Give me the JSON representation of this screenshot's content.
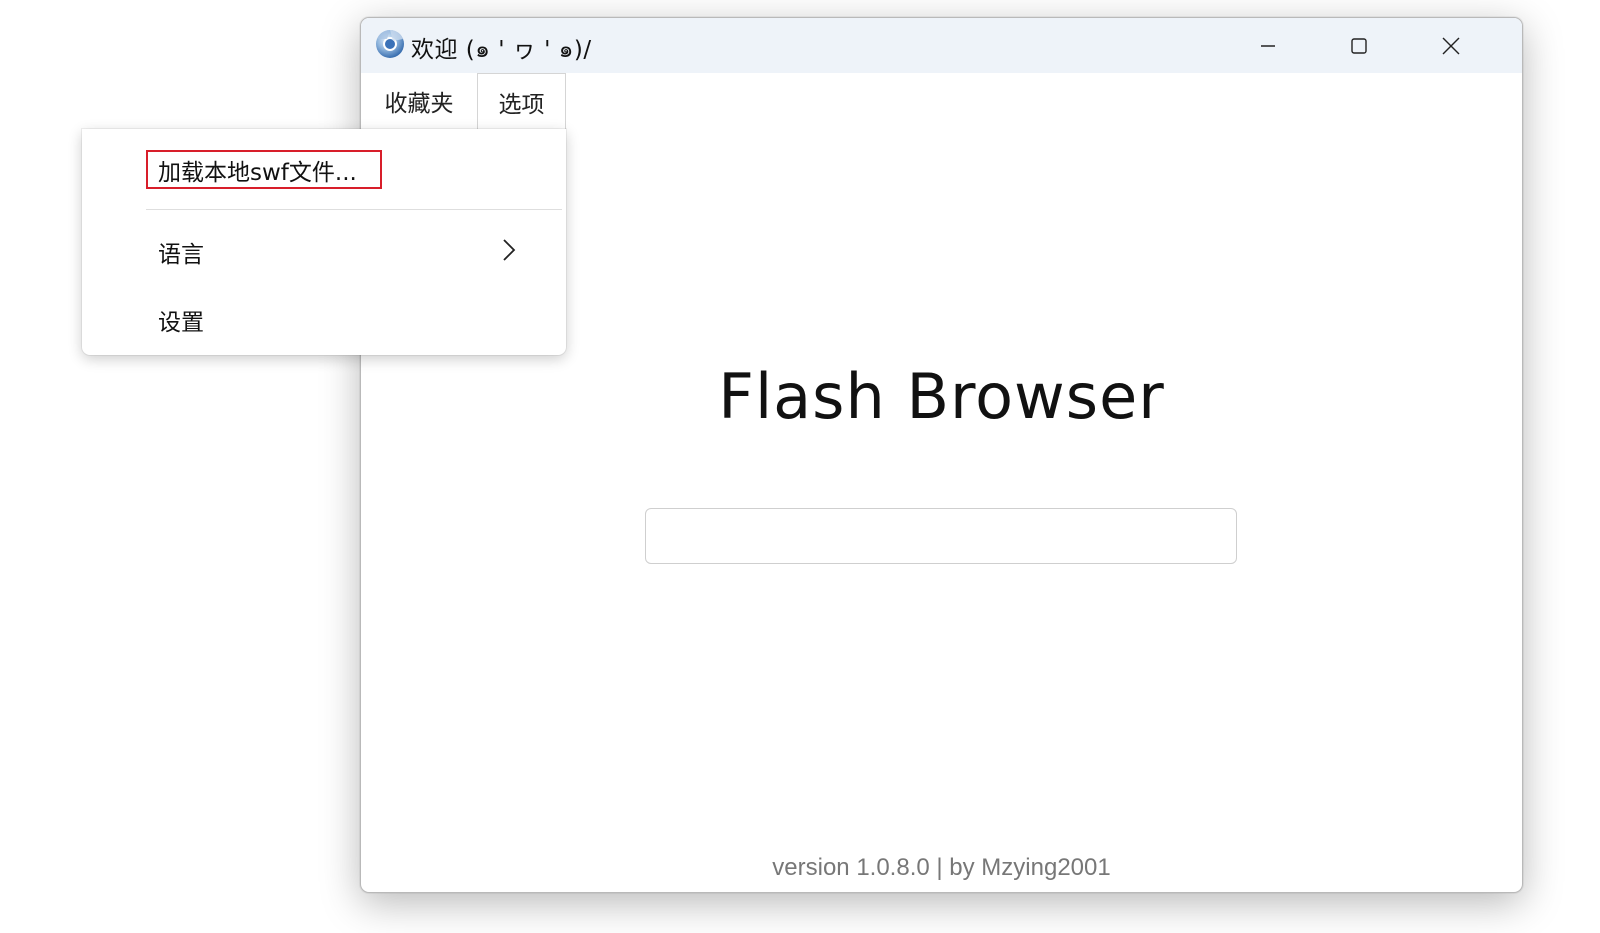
{
  "window": {
    "title": "欢迎 (๑ ' ヮ ' ๑)/",
    "app_name": "Flash Browser",
    "version_text": "version 1.0.8.0 | by Mzying2001"
  },
  "titlebar_buttons": {
    "minimize_icon": "minimize-icon",
    "maximize_icon": "maximize-icon",
    "close_icon": "close-icon"
  },
  "menubar": {
    "favorites_label": "收藏夹",
    "options_label": "选项"
  },
  "options_menu": {
    "load_swf_label": "加载本地swf文件...",
    "language_label": "语言",
    "settings_label": "设置"
  },
  "address_input": {
    "value": "",
    "placeholder": ""
  },
  "colors": {
    "titlebar_bg": "#eef3f9",
    "highlight_border": "#d81e2a",
    "version_text": "#777777"
  }
}
